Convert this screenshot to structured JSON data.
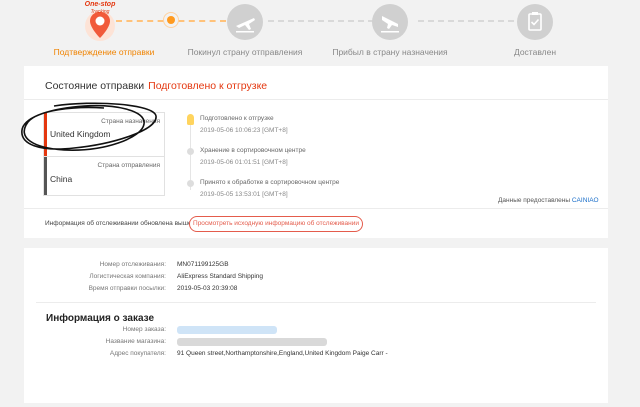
{
  "progress": {
    "logo_text_1": "One-stop",
    "logo_text_2": "Tracking",
    "steps": [
      {
        "label": "Подтверждение отправки",
        "active": true,
        "icon": "map-pin-icon"
      },
      {
        "label": "Покинул страну отправления",
        "active": false,
        "icon": "plane-departure-icon"
      },
      {
        "label": "Прибыл в страну назначения",
        "active": false,
        "icon": "plane-arrival-icon"
      },
      {
        "label": "Доставлен",
        "active": false,
        "icon": "clipboard-check-icon"
      }
    ]
  },
  "status": {
    "label": "Состояние отправки",
    "value": "Подготовлено к отгрузке"
  },
  "destination": {
    "caption": "Страна назначения",
    "country": "United Kingdom",
    "color": "#e4370f"
  },
  "origin": {
    "caption": "Страна отправления",
    "country": "China",
    "color": "#555555"
  },
  "timeline": [
    {
      "event": "Подготовлено к отгрузке",
      "time": "2019-05-06 10:06:23 [GMT+8]"
    },
    {
      "event": "Хранение в сортировочном центре",
      "time": "2019-05-06 01:01:51 [GMT+8]"
    },
    {
      "event": "Принято к обработке в сортировочном центре",
      "time": "2019-05-05 13:53:01 [GMT+8]"
    }
  ],
  "provider": {
    "text": "Данные предоставлены",
    "name": "CAINIAO"
  },
  "update_info": {
    "text": "Информация об отслеживании обновлена выше",
    "button": "Просмотреть исходную информацию об отслеживании"
  },
  "shipment": {
    "tracking_label": "Номер отслеживания:",
    "tracking_value": "MN071199125GB",
    "carrier_label": "Логистическая компания:",
    "carrier_value": "AliExpress Standard Shipping",
    "ship_time_label": "Время отправки посылки:",
    "ship_time_value": "2019-05-03 20:39:08"
  },
  "order": {
    "title": "Информация о заказе",
    "number_label": "Номер заказа:",
    "store_label": "Название магазина:",
    "address_label": "Адрес покупателя:",
    "address_value": "91 Queen street,Northamptonshire,England,United Kingdom Paige Carr -"
  },
  "colors": {
    "accent_orange": "#f08300",
    "alert_red": "#e4370f",
    "link_blue": "#1a6ec9"
  }
}
